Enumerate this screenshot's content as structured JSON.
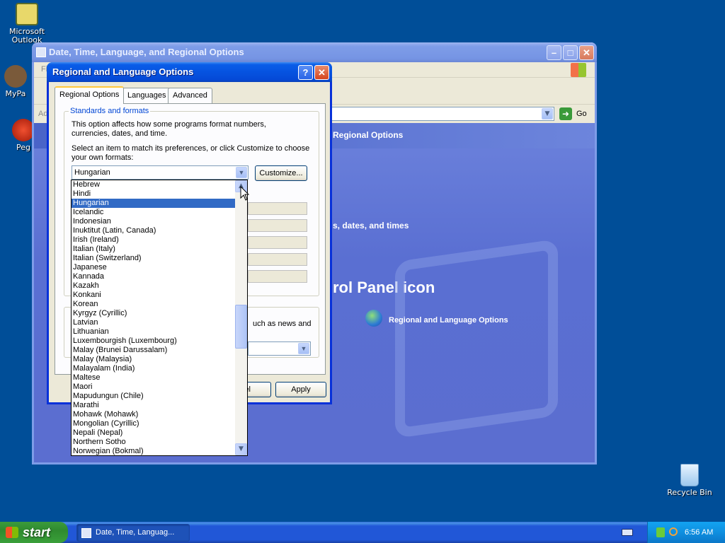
{
  "desktop": {
    "icons": [
      {
        "label": "Microsoft Outlook"
      },
      {
        "label": "MyPa"
      },
      {
        "label": "Peg"
      },
      {
        "label": "Recycle Bin"
      }
    ]
  },
  "control_panel": {
    "title": "Date, Time, Language, and Regional Options",
    "menu_first": "Fi",
    "address_prefix": "Ad",
    "go_label": "Go",
    "heading_fragment": "Regional Options",
    "task_fragment": "s, dates, and times",
    "panel_icon_fragment": "rol Panel icon",
    "regional_link": "Regional and Language Options"
  },
  "dialog": {
    "title": "Regional and Language Options",
    "help_label": "?",
    "close_label": "✕",
    "tabs": [
      {
        "label": "Regional Options"
      },
      {
        "label": "Languages"
      },
      {
        "label": "Advanced"
      }
    ],
    "group_title": "Standards and formats",
    "group_desc": "This option affects how some programs format numbers, currencies, dates, and time.",
    "select_desc": "Select an item to match its preferences, or click Customize to choose your own formats:",
    "selected_locale": "Hungarian",
    "customize_label": "Customize...",
    "location_fragment": "uch as news and",
    "cancel_fragment": "el",
    "apply_label": "Apply"
  },
  "locale_list": {
    "selected_index": 2,
    "items": [
      "Hebrew",
      "Hindi",
      "Hungarian",
      "Icelandic",
      "Indonesian",
      "Inuktitut (Latin, Canada)",
      "Irish (Ireland)",
      "Italian (Italy)",
      "Italian (Switzerland)",
      "Japanese",
      "Kannada",
      "Kazakh",
      "Konkani",
      "Korean",
      "Kyrgyz (Cyrillic)",
      "Latvian",
      "Lithuanian",
      "Luxembourgish (Luxembourg)",
      "Malay (Brunei Darussalam)",
      "Malay (Malaysia)",
      "Malayalam (India)",
      "Maltese",
      "Maori",
      "Mapudungun (Chile)",
      "Marathi",
      "Mohawk (Mohawk)",
      "Mongolian (Cyrillic)",
      "Nepali (Nepal)",
      "Northern Sotho",
      "Norwegian (Bokmal)"
    ]
  },
  "taskbar": {
    "start_label": "start",
    "task_item": "Date, Time, Languag...",
    "clock": "6:56 AM"
  }
}
